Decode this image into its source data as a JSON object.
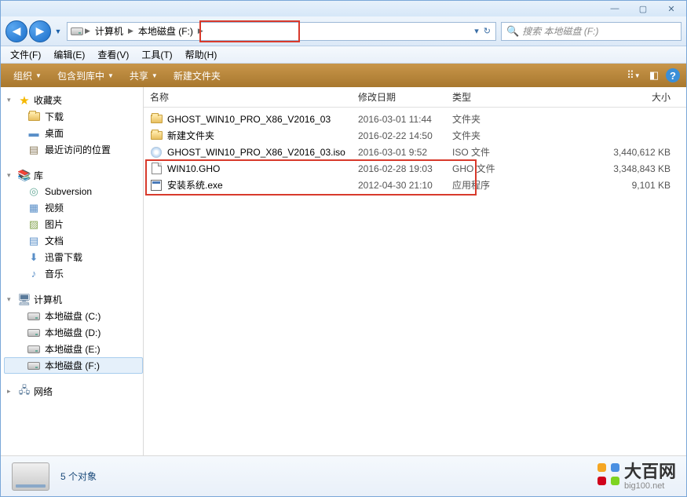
{
  "title_controls": {
    "min": "—",
    "max": "▢",
    "close": "✕"
  },
  "nav": {
    "back": "◀",
    "forward": "▶",
    "dropdown": "▼",
    "breadcrumb": [
      {
        "label": "计算机"
      },
      {
        "label": "本地磁盘 (F:)"
      }
    ],
    "refresh": "↻"
  },
  "search": {
    "icon": "🔍",
    "placeholder": "搜索 本地磁盘 (F:)"
  },
  "menubar": [
    {
      "label": "文件(F)"
    },
    {
      "label": "编辑(E)"
    },
    {
      "label": "查看(V)"
    },
    {
      "label": "工具(T)"
    },
    {
      "label": "帮助(H)"
    }
  ],
  "cmdbar": {
    "organize": "组织",
    "include": "包含到库中",
    "share": "共享",
    "newfolder": "新建文件夹"
  },
  "tree": {
    "favorites": {
      "label": "收藏夹",
      "items": [
        "下载",
        "桌面",
        "最近访问的位置"
      ]
    },
    "libraries": {
      "label": "库",
      "items": [
        "Subversion",
        "视频",
        "图片",
        "文档",
        "迅雷下载",
        "音乐"
      ]
    },
    "computer": {
      "label": "计算机",
      "items": [
        "本地磁盘 (C:)",
        "本地磁盘 (D:)",
        "本地磁盘 (E:)",
        "本地磁盘 (F:)"
      ]
    },
    "network": {
      "label": "网络"
    }
  },
  "columns": {
    "name": "名称",
    "date": "修改日期",
    "type": "类型",
    "size": "大小"
  },
  "rows": [
    {
      "icon": "folder",
      "name": "GHOST_WIN10_PRO_X86_V2016_03",
      "date": "2016-03-01 11:44",
      "type": "文件夹",
      "size": ""
    },
    {
      "icon": "folder",
      "name": "新建文件夹",
      "date": "2016-02-22 14:50",
      "type": "文件夹",
      "size": ""
    },
    {
      "icon": "iso",
      "name": "GHOST_WIN10_PRO_X86_V2016_03.iso",
      "date": "2016-03-01 9:52",
      "type": "ISO 文件",
      "size": "3,440,612 KB"
    },
    {
      "icon": "file",
      "name": "WIN10.GHO",
      "date": "2016-02-28 19:03",
      "type": "GHO 文件",
      "size": "3,348,843 KB"
    },
    {
      "icon": "exe",
      "name": "安装系统.exe",
      "date": "2012-04-30 21:10",
      "type": "应用程序",
      "size": "9,101 KB"
    }
  ],
  "status": {
    "count": "5 个对象"
  },
  "watermark": {
    "main": "大百网",
    "sub": "big100.net"
  }
}
